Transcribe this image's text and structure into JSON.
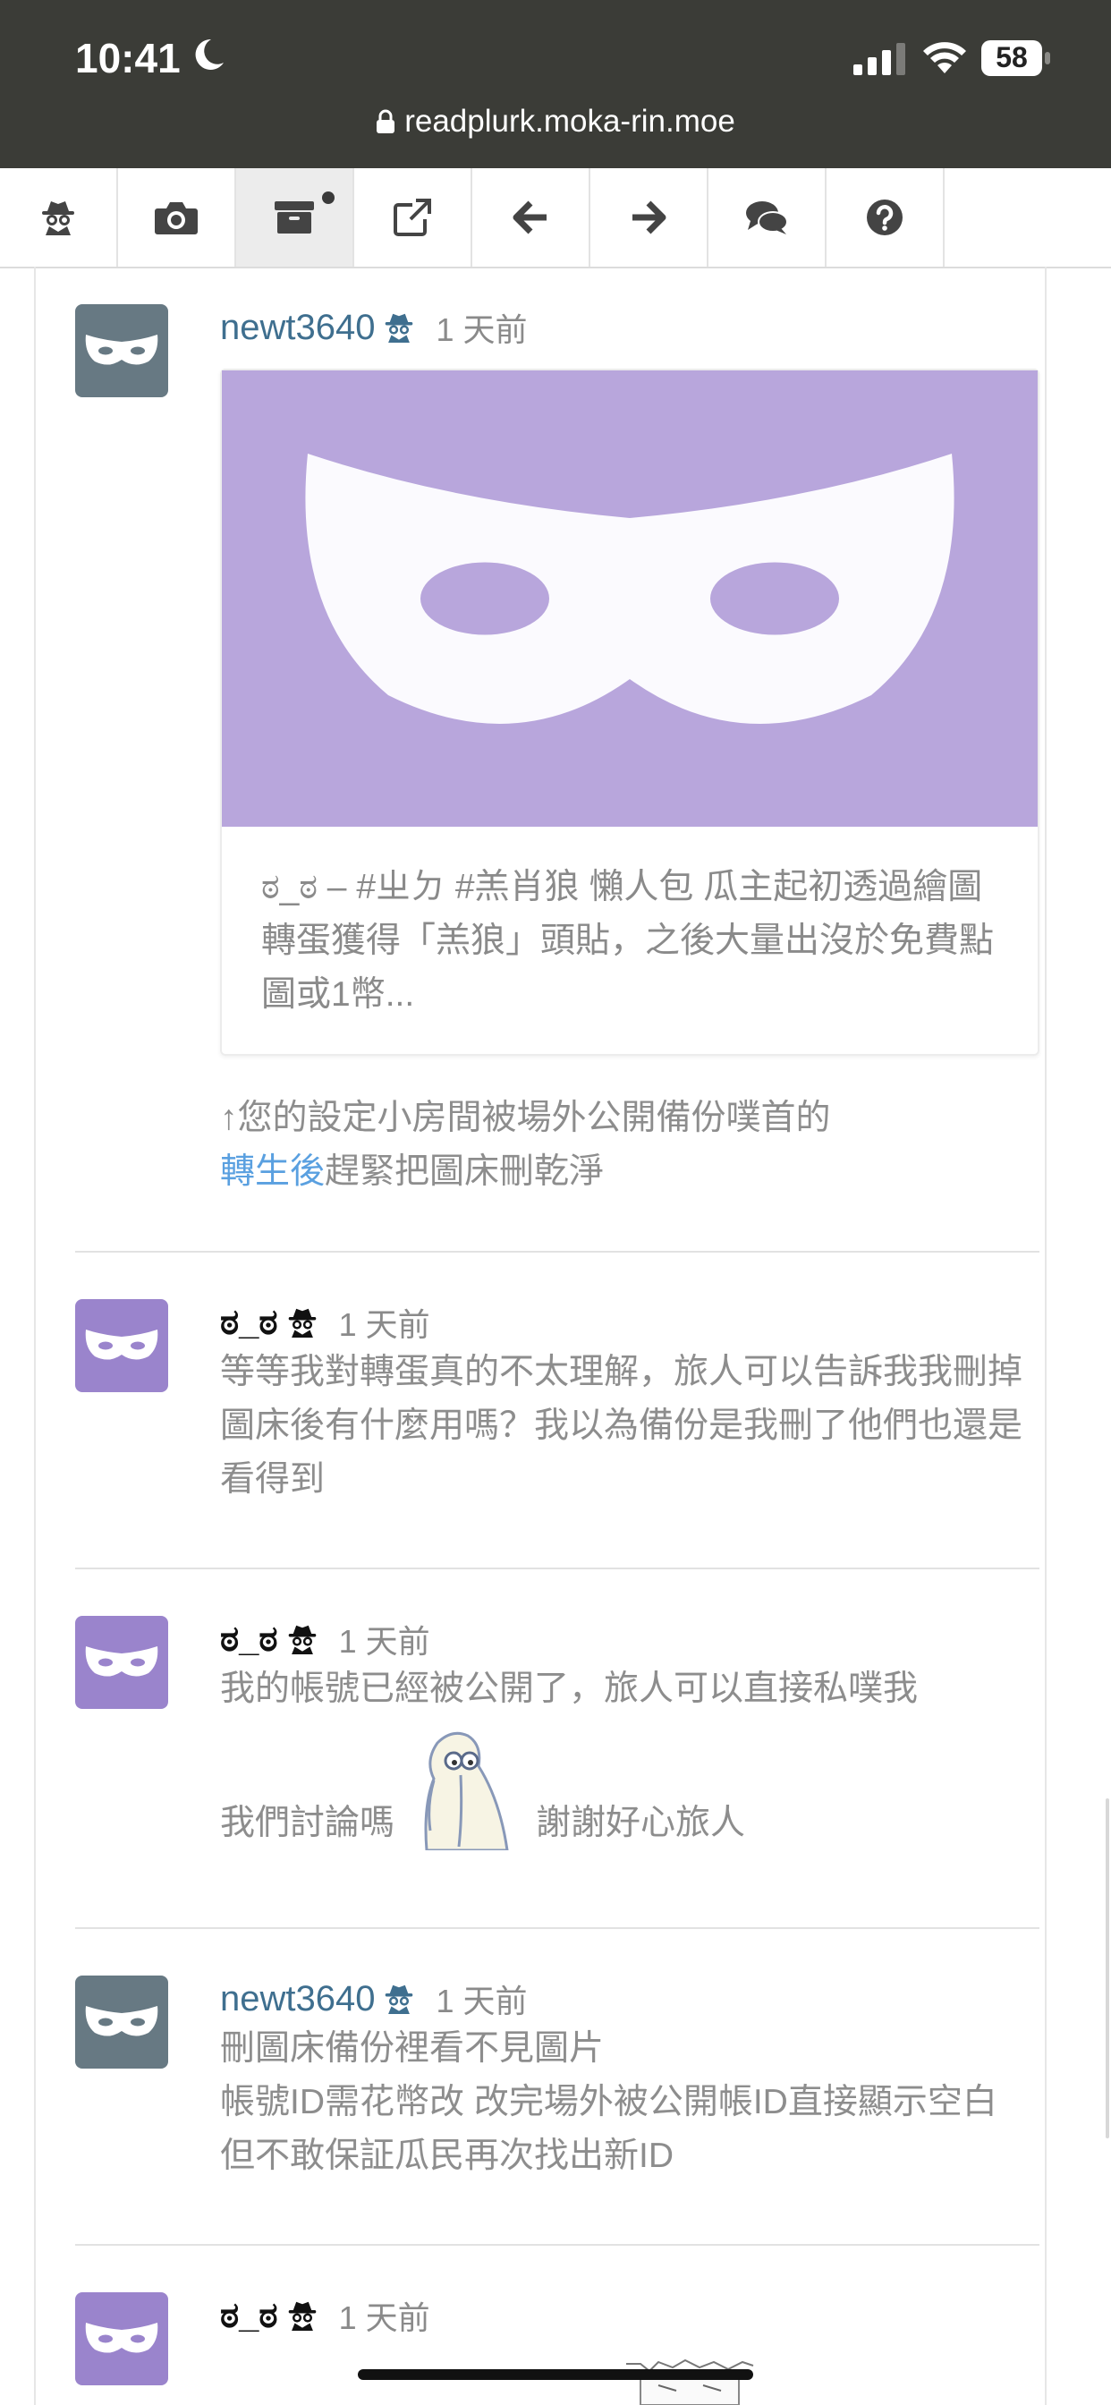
{
  "status": {
    "time": "10:41",
    "battery": "58"
  },
  "browser": {
    "url": "readplurk.moka-rin.moe"
  },
  "toolbar": {
    "buttons": [
      {
        "icon": "spy-icon"
      },
      {
        "icon": "camera-icon"
      },
      {
        "icon": "archive-icon",
        "active": true
      },
      {
        "icon": "external-link-icon"
      },
      {
        "icon": "arrow-left-icon"
      },
      {
        "icon": "arrow-right-icon"
      },
      {
        "icon": "comments-icon"
      },
      {
        "icon": "help-icon"
      }
    ]
  },
  "posts": [
    {
      "user": "newt3640",
      "time": "1 天前",
      "card_desc": "ಠ_ಠ – #ㄓㄉ #羔肖狼 懶人包 瓜主起初透過繪圖轉蛋獲得「羔狼」頭貼，之後大量出沒於免費點圖或1幣...",
      "text_pre": "↑您的設定小房間被場外公開備份噗首的",
      "text_link": "轉生後",
      "text_post": "趕緊把圖床刪乾淨"
    },
    {
      "user": "ಠ_ಠ",
      "time": "1 天前",
      "text": "等等我對轉蛋真的不太理解，旅人可以告訴我我刪掉圖床後有什麼用嗎？我以為備份是我刪了他們也還是看得到"
    },
    {
      "user": "ಠ_ಠ",
      "time": "1 天前",
      "text_line1": "我的帳號已經被公開了，旅人可以直接私噗我",
      "text_line2a": "我們討論嗎",
      "text_line2b": "謝謝好心旅人"
    },
    {
      "user": "newt3640",
      "time": "1 天前",
      "text_line1": "刪圖床備份裡看不見圖片",
      "text_line2": "帳號ID需花幣改 改完場外被公開帳ID直接顯示空白 但不敢保証瓜民再次找出新ID"
    },
    {
      "user": "ಠ_ಠ",
      "time": "1 天前"
    }
  ],
  "colors": {
    "topbar": "#3b3c37",
    "username": "#3f6f8f",
    "link": "#5aa0e0",
    "avatar_gray": "#677983",
    "avatar_purple": "#9a84cc"
  }
}
